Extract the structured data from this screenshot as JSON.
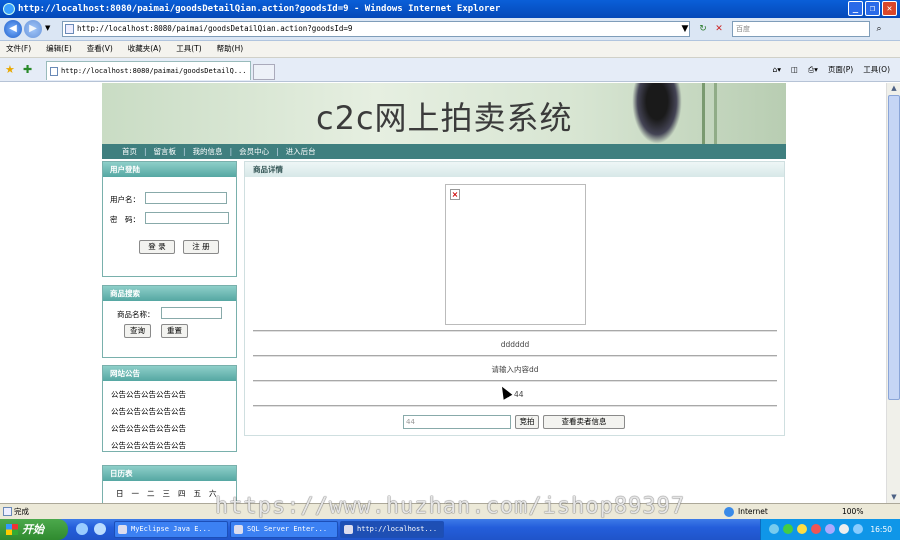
{
  "window": {
    "title": "http://localhost:8080/paimai/goodsDetailQian.action?goodsId=9 - Windows Internet Explorer"
  },
  "browser": {
    "address": "http://localhost:8080/paimai/goodsDetailQian.action?goodsId=9",
    "search_placeholder": "百度",
    "menu": [
      "文件(F)",
      "编辑(E)",
      "查看(V)",
      "收藏夹(A)",
      "工具(T)",
      "帮助(H)"
    ],
    "tab_title": "http://localhost:8080/paimai/goodsDetailQ...",
    "cmd_page": "页面(P)",
    "cmd_tools": "工具(O)"
  },
  "site": {
    "title": "c2c网上拍卖系统",
    "nav": [
      "首页",
      "留言板",
      "我的信息",
      "会员中心",
      "进入后台"
    ]
  },
  "login": {
    "header": "用户登陆",
    "username_label": "用户名：",
    "password_label": "密　码：",
    "login_btn": "登  录",
    "register_btn": "注  册"
  },
  "goods_search": {
    "header": "商品搜索",
    "name_label": "商品名称：",
    "query_btn": "查询",
    "reset_btn": "重置"
  },
  "announcements": {
    "header": "网站公告",
    "items": [
      "公告公告公告公告公告",
      "公告公告公告公告公告",
      "公告公告公告公告公告",
      "公告公告公告公告公告"
    ]
  },
  "calendar": {
    "header": "日历表",
    "weekdays": [
      "日",
      "一",
      "二",
      "三",
      "四",
      "五",
      "六"
    ]
  },
  "detail": {
    "header": "商品详情",
    "name": "dddddd",
    "description": "请输入内容dd",
    "price_text": "：44",
    "bid_value": "44",
    "bid_btn": "竞拍",
    "seller_btn": "查看卖者信息"
  },
  "status": {
    "text": "完成",
    "zone": "Internet",
    "zoom": "100%"
  },
  "taskbar": {
    "start": "开始",
    "tasks": [
      "MyEclipse Java E...",
      "SQL Server Enter...",
      "http://localhost..."
    ],
    "clock": "16:50"
  },
  "watermark": "https://www.huzhan.com/ishop89397"
}
